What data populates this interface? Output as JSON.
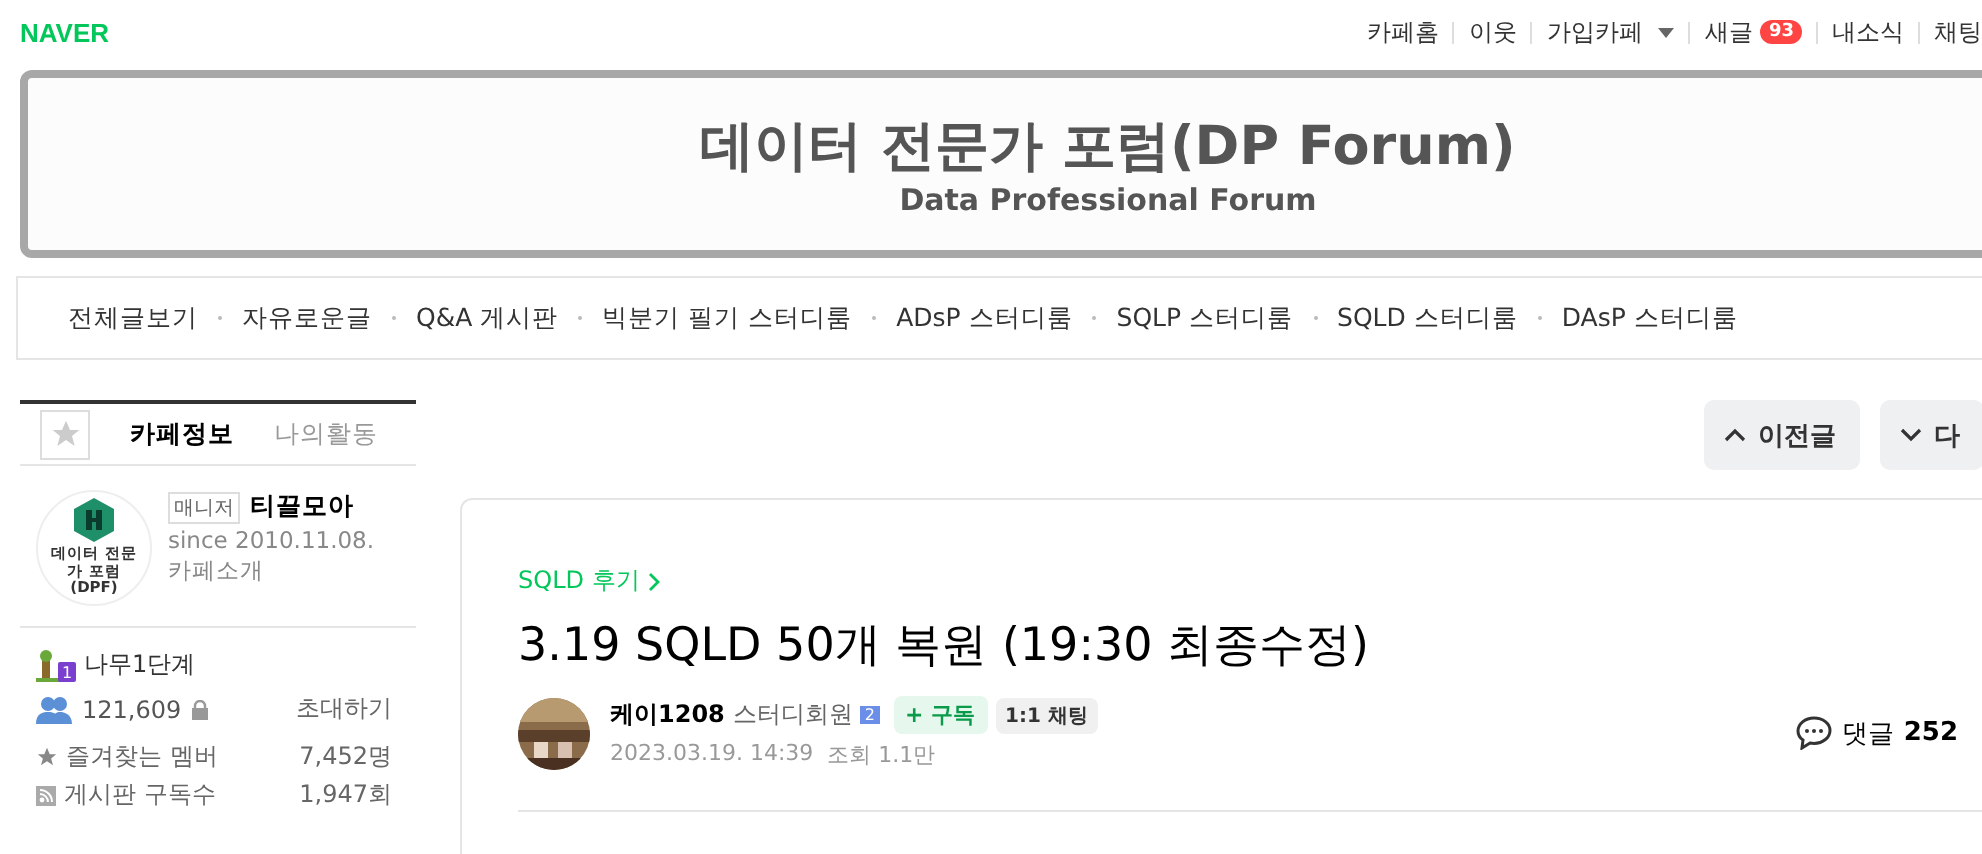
{
  "top_bar": {
    "logo": "NAVER",
    "links": [
      {
        "label": "카페홈",
        "kind": "link"
      },
      {
        "label": "이웃",
        "kind": "link"
      },
      {
        "label": "가입카페",
        "kind": "dropdown"
      },
      {
        "label": "새글",
        "kind": "badge",
        "badge": "93"
      },
      {
        "label": "내소식",
        "kind": "link"
      },
      {
        "label": "채팅",
        "kind": "link"
      }
    ]
  },
  "banner": {
    "title": "데이터 전문가 포럼(DP Forum)",
    "subtitle": "Data Professional Forum"
  },
  "menu": [
    "전체글보기",
    "자유로운글",
    "Q&A 게시판",
    "빅분기 필기 스터디룸",
    "ADsP 스터디룸",
    "SQLP 스터디룸",
    "SQLD 스터디룸",
    "DAsP 스터디룸"
  ],
  "sidebar": {
    "tabs": [
      {
        "label": "카페정보",
        "selected": true
      },
      {
        "label": "나의활동",
        "selected": false
      }
    ],
    "cafe": {
      "logo_text": "데이터 전문가 포럼(DPF)",
      "role": "매니저",
      "manager": "티끌모아",
      "since": "since 2010.11.08.",
      "intro": "카페소개"
    },
    "level": "나무1단계",
    "level_badge": "1",
    "members": "121,609",
    "invite": "초대하기",
    "stats": [
      {
        "label": "즐겨찾는 멤버",
        "value": "7,452명",
        "kind": "star"
      },
      {
        "label": "게시판 구독수",
        "value": "1,947회",
        "kind": "rss"
      }
    ]
  },
  "nav_buttons": [
    {
      "label": "이전글",
      "kind": "up"
    },
    {
      "label": "다",
      "kind": "down"
    }
  ],
  "article": {
    "category": "SQLD 후기",
    "title": "3.19 SQLD 50개 복원 (19:30 최종수정)",
    "author": "케이1208",
    "grade": "스터디회원",
    "grade_badge": "2",
    "subscribe": "+ 구독",
    "chat": "1:1 채팅",
    "date": "2023.03.19. 14:39",
    "views": "조회 1.1만",
    "comments_label": "댓글",
    "comments": "252"
  }
}
